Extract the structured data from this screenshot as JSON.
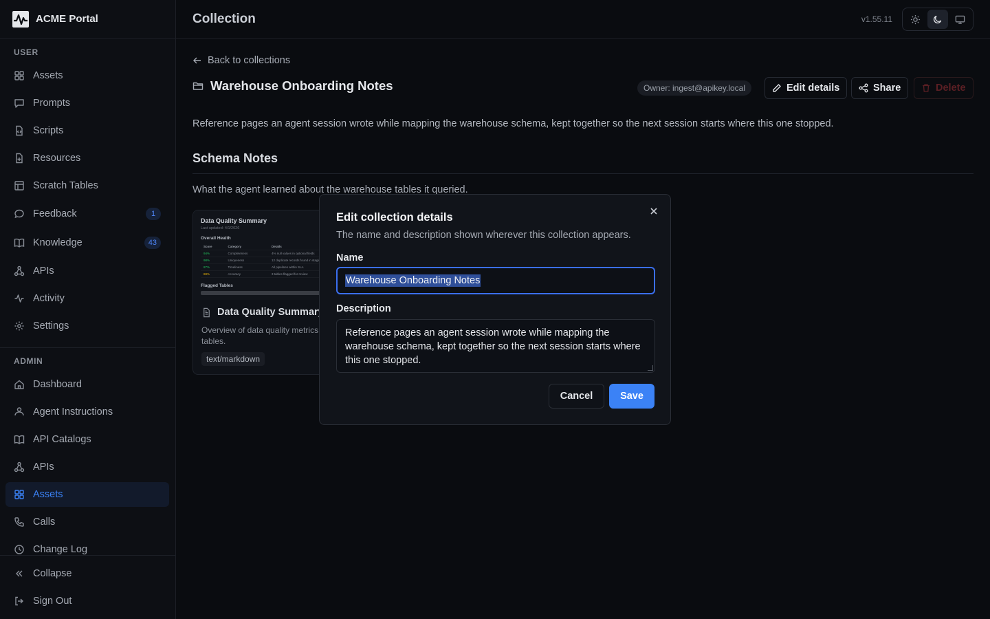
{
  "app": {
    "name": "ACME Portal",
    "version": "v1.55.11"
  },
  "sidebar": {
    "user_label": "USER",
    "user_items": [
      {
        "label": "Assets",
        "icon": "grid-icon"
      },
      {
        "label": "Prompts",
        "icon": "chat-icon"
      },
      {
        "label": "Scripts",
        "icon": "file-code-icon"
      },
      {
        "label": "Resources",
        "icon": "file-plus-icon"
      },
      {
        "label": "Scratch Tables",
        "icon": "table-icon"
      },
      {
        "label": "Feedback",
        "icon": "message-icon",
        "badge": "1"
      },
      {
        "label": "Knowledge",
        "icon": "book-icon",
        "badge": "43"
      },
      {
        "label": "APIs",
        "icon": "network-icon"
      },
      {
        "label": "Activity",
        "icon": "activity-icon"
      },
      {
        "label": "Settings",
        "icon": "gear-icon"
      }
    ],
    "admin_label": "ADMIN",
    "admin_items": [
      {
        "label": "Dashboard",
        "icon": "home-icon"
      },
      {
        "label": "Agent Instructions",
        "icon": "bot-icon"
      },
      {
        "label": "API Catalogs",
        "icon": "book-icon"
      },
      {
        "label": "APIs",
        "icon": "network-icon"
      },
      {
        "label": "Assets",
        "icon": "grid-icon",
        "active": true
      },
      {
        "label": "Calls",
        "icon": "phone-icon"
      },
      {
        "label": "Change Log",
        "icon": "clock-icon"
      }
    ],
    "collapse_label": "Collapse",
    "signout_label": "Sign Out"
  },
  "header": {
    "title": "Collection"
  },
  "collection": {
    "back_label": "Back to collections",
    "title": "Warehouse Onboarding Notes",
    "owner": "Owner: ingest@apikey.local",
    "edit_label": "Edit details",
    "share_label": "Share",
    "delete_label": "Delete",
    "description": "Reference pages an agent session wrote while mapping the warehouse schema, kept together so the next session starts where this one stopped.",
    "section_title": "Schema Notes",
    "section_sub": "What the agent learned about the warehouse tables it queried."
  },
  "card": {
    "preview": {
      "title": "Data Quality Summary",
      "date": "Last updated: 4/1/2026",
      "health_heading": "Overall Health",
      "columns": [
        "Score",
        "Category",
        "Details"
      ],
      "rows": [
        {
          "score": "94%",
          "category": "Completeness",
          "details": "4% null values in optional fields",
          "status": "good"
        },
        {
          "score": "98%",
          "category": "Uniqueness",
          "details": "12 duplicate records found in staging",
          "status": "good"
        },
        {
          "score": "87%",
          "category": "Timeliness",
          "details": "All pipelines within SLA",
          "status": "good"
        },
        {
          "score": "88%",
          "category": "Accuracy",
          "details": "3 tables flagged for review",
          "status": "warn"
        }
      ],
      "flagged_heading": "Flagged Tables"
    },
    "title": "Data Quality Summary",
    "description": "Overview of data quality metrics across key tables.",
    "mime": "text/markdown"
  },
  "modal": {
    "title": "Edit collection details",
    "subtitle": "The name and description shown wherever this collection appears.",
    "name_label": "Name",
    "name_value": "Warehouse Onboarding Notes",
    "description_label": "Description",
    "description_value": "Reference pages an agent session wrote while mapping the warehouse schema, kept together so the next session starts where this one stopped.",
    "cancel_label": "Cancel",
    "save_label": "Save"
  },
  "colors": {
    "accent": "#3b82f6",
    "background": "#0a0c10",
    "danger": "#ef4444"
  }
}
